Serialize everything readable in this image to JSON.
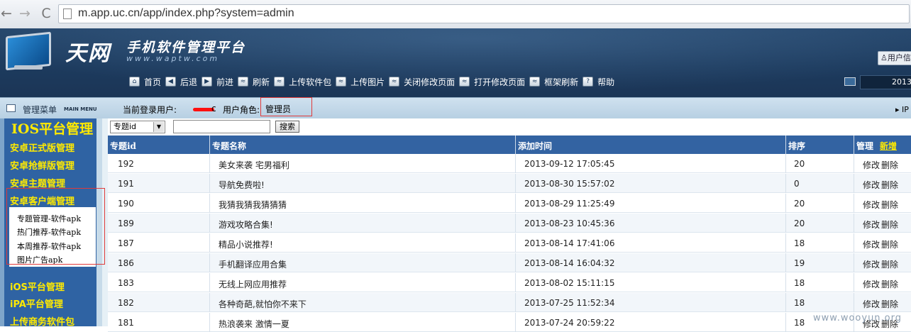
{
  "browser": {
    "url": "m.app.uc.cn/app/index.php?system=admin",
    "back_glyph": "←",
    "forward_glyph": "→",
    "reload_glyph": "C"
  },
  "banner": {
    "logo": "天网",
    "title": "手机软件管理平台",
    "subtitle": "www.waptw.com",
    "user_info_btn": "用户信",
    "date": "2013-"
  },
  "toolbar": {
    "items": [
      "首页",
      "后退",
      "前进",
      "刷新",
      "上传软件包",
      "上传图片",
      "关闭修改页面",
      "打开修改页面",
      "框架刷新",
      "帮助"
    ]
  },
  "menubar": {
    "title": "管理菜单",
    "title_en": "MAIN MENU",
    "login_label": "当前登录用户:",
    "login_tail": "c",
    "role_label": "用户角色:",
    "role_value": "管理员",
    "ip": "IP"
  },
  "sidebar": {
    "head": "IOS平台管理",
    "items": [
      "安卓正式版管理",
      "安卓抢鲜版管理",
      "安卓主题管理",
      "安卓客户端管理"
    ],
    "sub_items": [
      "专题管理-软件apk",
      "热门推荐-软件apk",
      "本周推荐-软件apk",
      "图片广告apk"
    ],
    "bottom_items": [
      "iOS平台管理",
      "iPA平台管理",
      "上传商务软件包"
    ]
  },
  "search": {
    "select_value": "专题id",
    "button": "搜索"
  },
  "table": {
    "headers": [
      "专题id",
      "专题名称",
      "添加时间",
      "排序",
      "管理"
    ],
    "add_label": "新增",
    "edit_label": "修改",
    "delete_label": "删除",
    "rows": [
      {
        "id": "192",
        "name": "美女来袭 宅男福利",
        "time": "2013-09-12 17:05:45",
        "sort": "20"
      },
      {
        "id": "191",
        "name": "导航免费啦!",
        "time": "2013-08-30 15:57:02",
        "sort": "0"
      },
      {
        "id": "190",
        "name": "我猜我猜我猜猜猜",
        "time": "2013-08-29 11:25:49",
        "sort": "20"
      },
      {
        "id": "189",
        "name": "游戏攻略合集!",
        "time": "2013-08-23 10:45:36",
        "sort": "20"
      },
      {
        "id": "187",
        "name": "精品小说推荐!",
        "time": "2013-08-14 17:41:06",
        "sort": "18"
      },
      {
        "id": "186",
        "name": "手机翻译应用合集",
        "time": "2013-08-14 16:04:32",
        "sort": "19"
      },
      {
        "id": "183",
        "name": "无线上网应用推荐",
        "time": "2013-08-02 15:11:15",
        "sort": "18"
      },
      {
        "id": "182",
        "name": "各种奇葩,就怕你不来下",
        "time": "2013-07-25 11:52:34",
        "sort": "18"
      },
      {
        "id": "181",
        "name": "热浪袭来 激情一夏",
        "time": "2013-07-24 20:59:22",
        "sort": "18"
      }
    ]
  },
  "watermark": "www.wooyun.org"
}
